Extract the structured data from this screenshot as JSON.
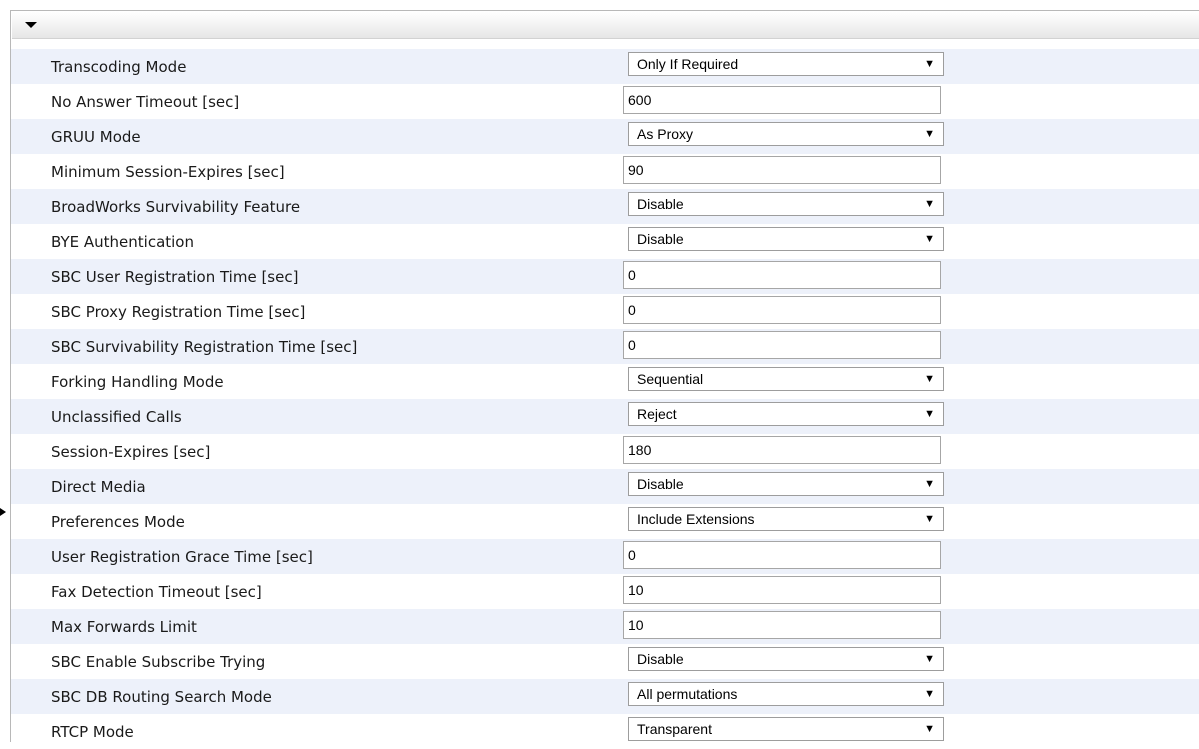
{
  "section": {
    "toggle_icon": "collapse-triangle-icon"
  },
  "rows": [
    {
      "label": "Transcoding Mode",
      "type": "select",
      "value": "Only If Required"
    },
    {
      "label": "No Answer Timeout [sec]",
      "type": "input",
      "value": "600"
    },
    {
      "label": "GRUU Mode",
      "type": "select",
      "value": "As Proxy"
    },
    {
      "label": "Minimum Session-Expires [sec]",
      "type": "input",
      "value": "90"
    },
    {
      "label": "BroadWorks Survivability Feature",
      "type": "select",
      "value": "Disable"
    },
    {
      "label": "BYE Authentication",
      "type": "select",
      "value": "Disable"
    },
    {
      "label": "SBC User Registration Time [sec]",
      "type": "input",
      "value": "0"
    },
    {
      "label": "SBC Proxy Registration Time [sec]",
      "type": "input",
      "value": "0"
    },
    {
      "label": "SBC Survivability Registration Time [sec]",
      "type": "input",
      "value": "0"
    },
    {
      "label": "Forking Handling Mode",
      "type": "select",
      "value": "Sequential"
    },
    {
      "label": "Unclassified Calls",
      "type": "select",
      "value": "Reject"
    },
    {
      "label": "Session-Expires [sec]",
      "type": "input",
      "value": "180"
    },
    {
      "label": "Direct Media",
      "type": "select",
      "value": "Disable"
    },
    {
      "label": "Preferences Mode",
      "type": "select",
      "value": "Include Extensions"
    },
    {
      "label": "User Registration Grace Time [sec]",
      "type": "input",
      "value": "0"
    },
    {
      "label": "Fax Detection Timeout [sec]",
      "type": "input",
      "value": "10"
    },
    {
      "label": "Max Forwards Limit",
      "type": "input",
      "value": "10"
    },
    {
      "label": "SBC Enable Subscribe Trying",
      "type": "select",
      "value": "Disable"
    },
    {
      "label": "SBC DB Routing Search Mode",
      "type": "select",
      "value": "All permutations"
    },
    {
      "label": "RTCP Mode",
      "type": "select",
      "value": "Transparent"
    }
  ],
  "dropdown_arrow_glyph": "▼",
  "colors": {
    "alt_row_bg": "#edf1fa",
    "frame_border": "#b8b8b8"
  }
}
